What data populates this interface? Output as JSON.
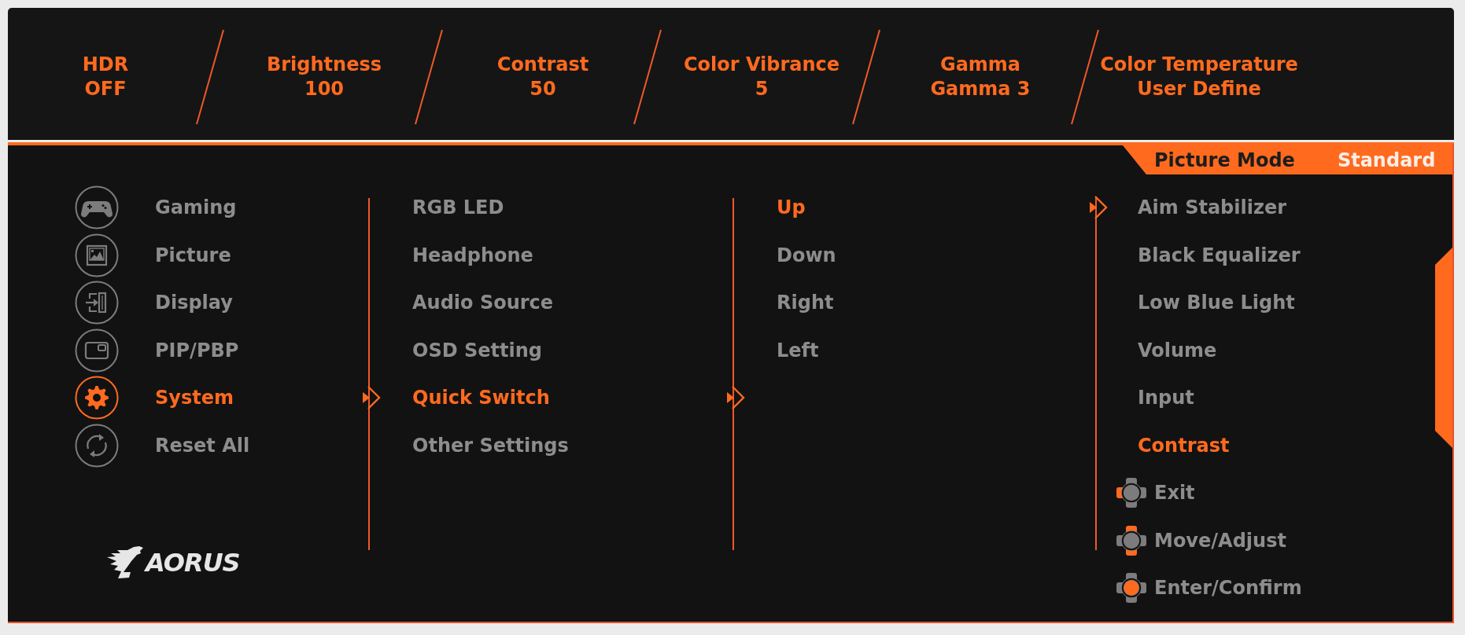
{
  "status_bar": [
    {
      "label": "HDR",
      "value": "OFF"
    },
    {
      "label": "Brightness",
      "value": "100"
    },
    {
      "label": "Contrast",
      "value": "50"
    },
    {
      "label": "Color Vibrance",
      "value": "5"
    },
    {
      "label": "Gamma",
      "value": "Gamma 3"
    },
    {
      "label": "Color Temperature",
      "value": "User Define"
    }
  ],
  "picture_mode": {
    "label": "Picture Mode",
    "value": "Standard"
  },
  "main_menu": [
    {
      "label": "Gaming",
      "selected": false
    },
    {
      "label": "Picture",
      "selected": false
    },
    {
      "label": "Display",
      "selected": false
    },
    {
      "label": "PIP/PBP",
      "selected": false
    },
    {
      "label": "System",
      "selected": true
    },
    {
      "label": "Reset All",
      "selected": false
    }
  ],
  "submenu": [
    {
      "label": "RGB LED",
      "selected": false
    },
    {
      "label": "Headphone",
      "selected": false
    },
    {
      "label": "Audio Source",
      "selected": false
    },
    {
      "label": "OSD Setting",
      "selected": false
    },
    {
      "label": "Quick Switch",
      "selected": true
    },
    {
      "label": "Other Settings",
      "selected": false
    }
  ],
  "options": [
    {
      "label": "Up",
      "selected": true
    },
    {
      "label": "Down",
      "selected": false
    },
    {
      "label": "Right",
      "selected": false
    },
    {
      "label": "Left",
      "selected": false
    }
  ],
  "functions": [
    {
      "label": "Aim Stabilizer",
      "selected": false
    },
    {
      "label": "Black Equalizer",
      "selected": false
    },
    {
      "label": "Low Blue Light",
      "selected": false
    },
    {
      "label": "Volume",
      "selected": false
    },
    {
      "label": "Input",
      "selected": false
    },
    {
      "label": "Contrast",
      "selected": true
    }
  ],
  "controls": [
    {
      "label": "Exit"
    },
    {
      "label": "Move/Adjust"
    },
    {
      "label": "Enter/Confirm"
    }
  ],
  "logo": {
    "text": "AORUS"
  }
}
